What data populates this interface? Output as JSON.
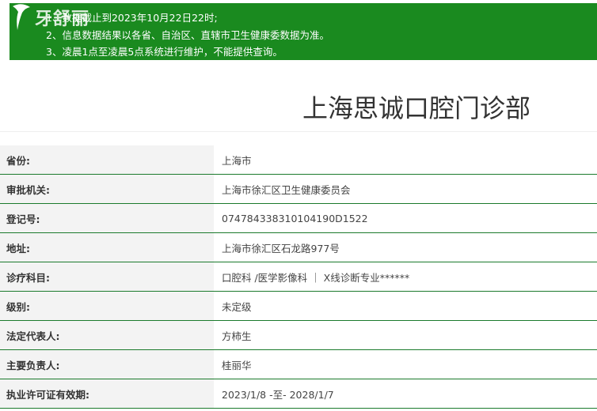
{
  "logo": {
    "text": "牙舒丽"
  },
  "notice": {
    "lines": [
      "1、数据截止到2023年10月22日22时;",
      "2、信息数据结果以各省、自治区、直辖市卫生健康委数据为准。",
      "3、凌晨1点至凌晨5点系统进行维护，不能提供查询。"
    ]
  },
  "page": {
    "title": "上海思诚口腔门诊部"
  },
  "rows": [
    {
      "label": "省份:",
      "value": "上海市"
    },
    {
      "label": "审批机关:",
      "value": "上海市徐汇区卫生健康委员会"
    },
    {
      "label": "登记号:",
      "value": "074784338310104190D1522"
    },
    {
      "label": "地址:",
      "value": "上海市徐汇区石龙路977号"
    },
    {
      "label": "诊疗科目:",
      "value": "口腔科 /医学影像科 ｜ X线诊断专业******"
    },
    {
      "label": "级别:",
      "value": "未定级"
    },
    {
      "label": "法定代表人:",
      "value": "方柿生"
    },
    {
      "label": "主要负责人:",
      "value": "桂丽华"
    },
    {
      "label": "执业许可证有效期:",
      "value": "2023/1/8 -至- 2028/1/7"
    }
  ],
  "colors": {
    "notice_bg": "#1a8a1f",
    "row_border": "#1b7a2c",
    "label_bg": "#f3f3f3"
  },
  "icons": {
    "logo": "tooth-logo-icon"
  }
}
